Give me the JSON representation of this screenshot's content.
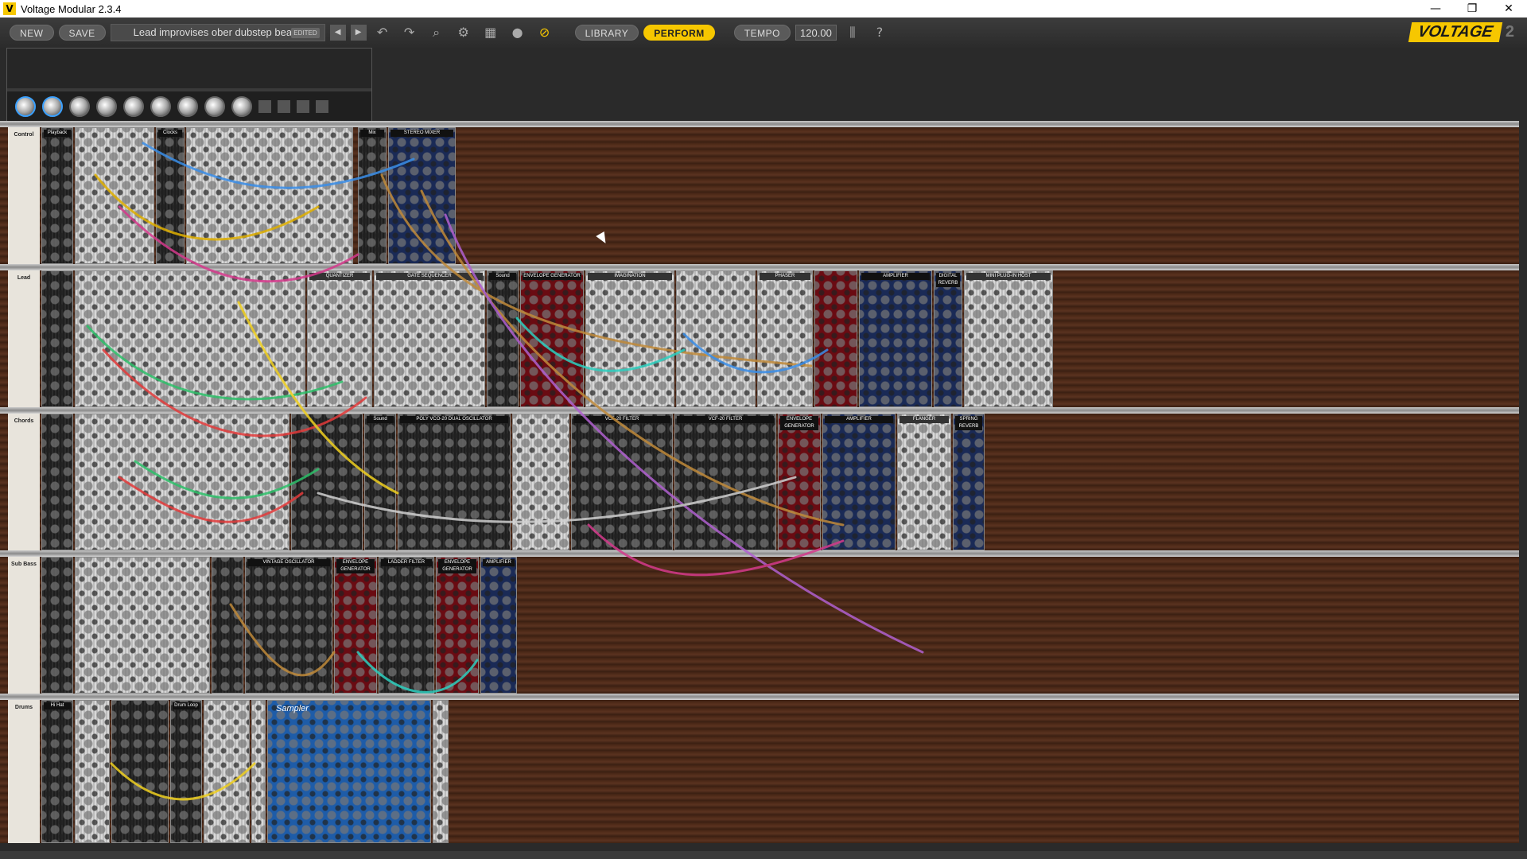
{
  "window": {
    "title": "Voltage Modular 2.3.4",
    "minimize": "—",
    "maximize": "❐",
    "close": "✕"
  },
  "toolbar": {
    "new_label": "NEW",
    "save_label": "SAVE",
    "preset_name": "Lead improvises ober dubstep beat",
    "edited_badge": "EDITED",
    "prev_icon": "◀",
    "next_icon": "▶",
    "library_label": "LIBRARY",
    "perform_label": "PERFORM",
    "tempo_label": "TEMPO",
    "tempo_value": "120.00",
    "help_icon": "?"
  },
  "logo": {
    "brand": "VOLTAGE",
    "version": "2"
  },
  "rows": [
    {
      "label": "Control"
    },
    {
      "label": "Lead"
    },
    {
      "label": "Chords"
    },
    {
      "label": "Sub Bass"
    },
    {
      "label": "Drums"
    }
  ],
  "modules": {
    "row1": [
      "Playback",
      "Clocks",
      "STEREO MIXER",
      "Mix"
    ],
    "row2": [
      "QUANTIZER",
      "GATE SEQUENCER",
      "Sound",
      "ENVELOPE GENERATOR",
      "IMAGINATION",
      "PHASER",
      "AMPLIFIER",
      "DIGITAL REVERB",
      "MINI PLUG-IN HOST"
    ],
    "row3": [
      "Sound",
      "POLY VCO-20 DUAL OSCILLATOR",
      "VCF-20 FILTER",
      "VCF-20 FILTER",
      "ENVELOPE GENERATOR",
      "AMPLIFIER",
      "FLANGER",
      "SPRING REVERB"
    ],
    "row4": [
      "VINTAGE OSCILLATOR",
      "ENVELOPE GENERATOR",
      "LADDER FILTER",
      "ENVELOPE GENERATOR",
      "AMPLIFIER"
    ],
    "row5": [
      "Hi Hat",
      "Drum Loop",
      "Sampler"
    ]
  },
  "icons": {
    "undo": "undo-icon",
    "redo": "redo-icon",
    "zoom": "zoom-icon",
    "settings": "gear-icon",
    "grid": "grid-icon",
    "color": "color-wheel-icon",
    "cable": "cable-icon",
    "keyboard": "midi-icon",
    "help": "help-icon"
  },
  "colors": {
    "accent": "#f6c700",
    "toolbar_bg": "#2b2b2b",
    "rack_wood": "#4d2a18",
    "rail": "#c9c9c9"
  }
}
